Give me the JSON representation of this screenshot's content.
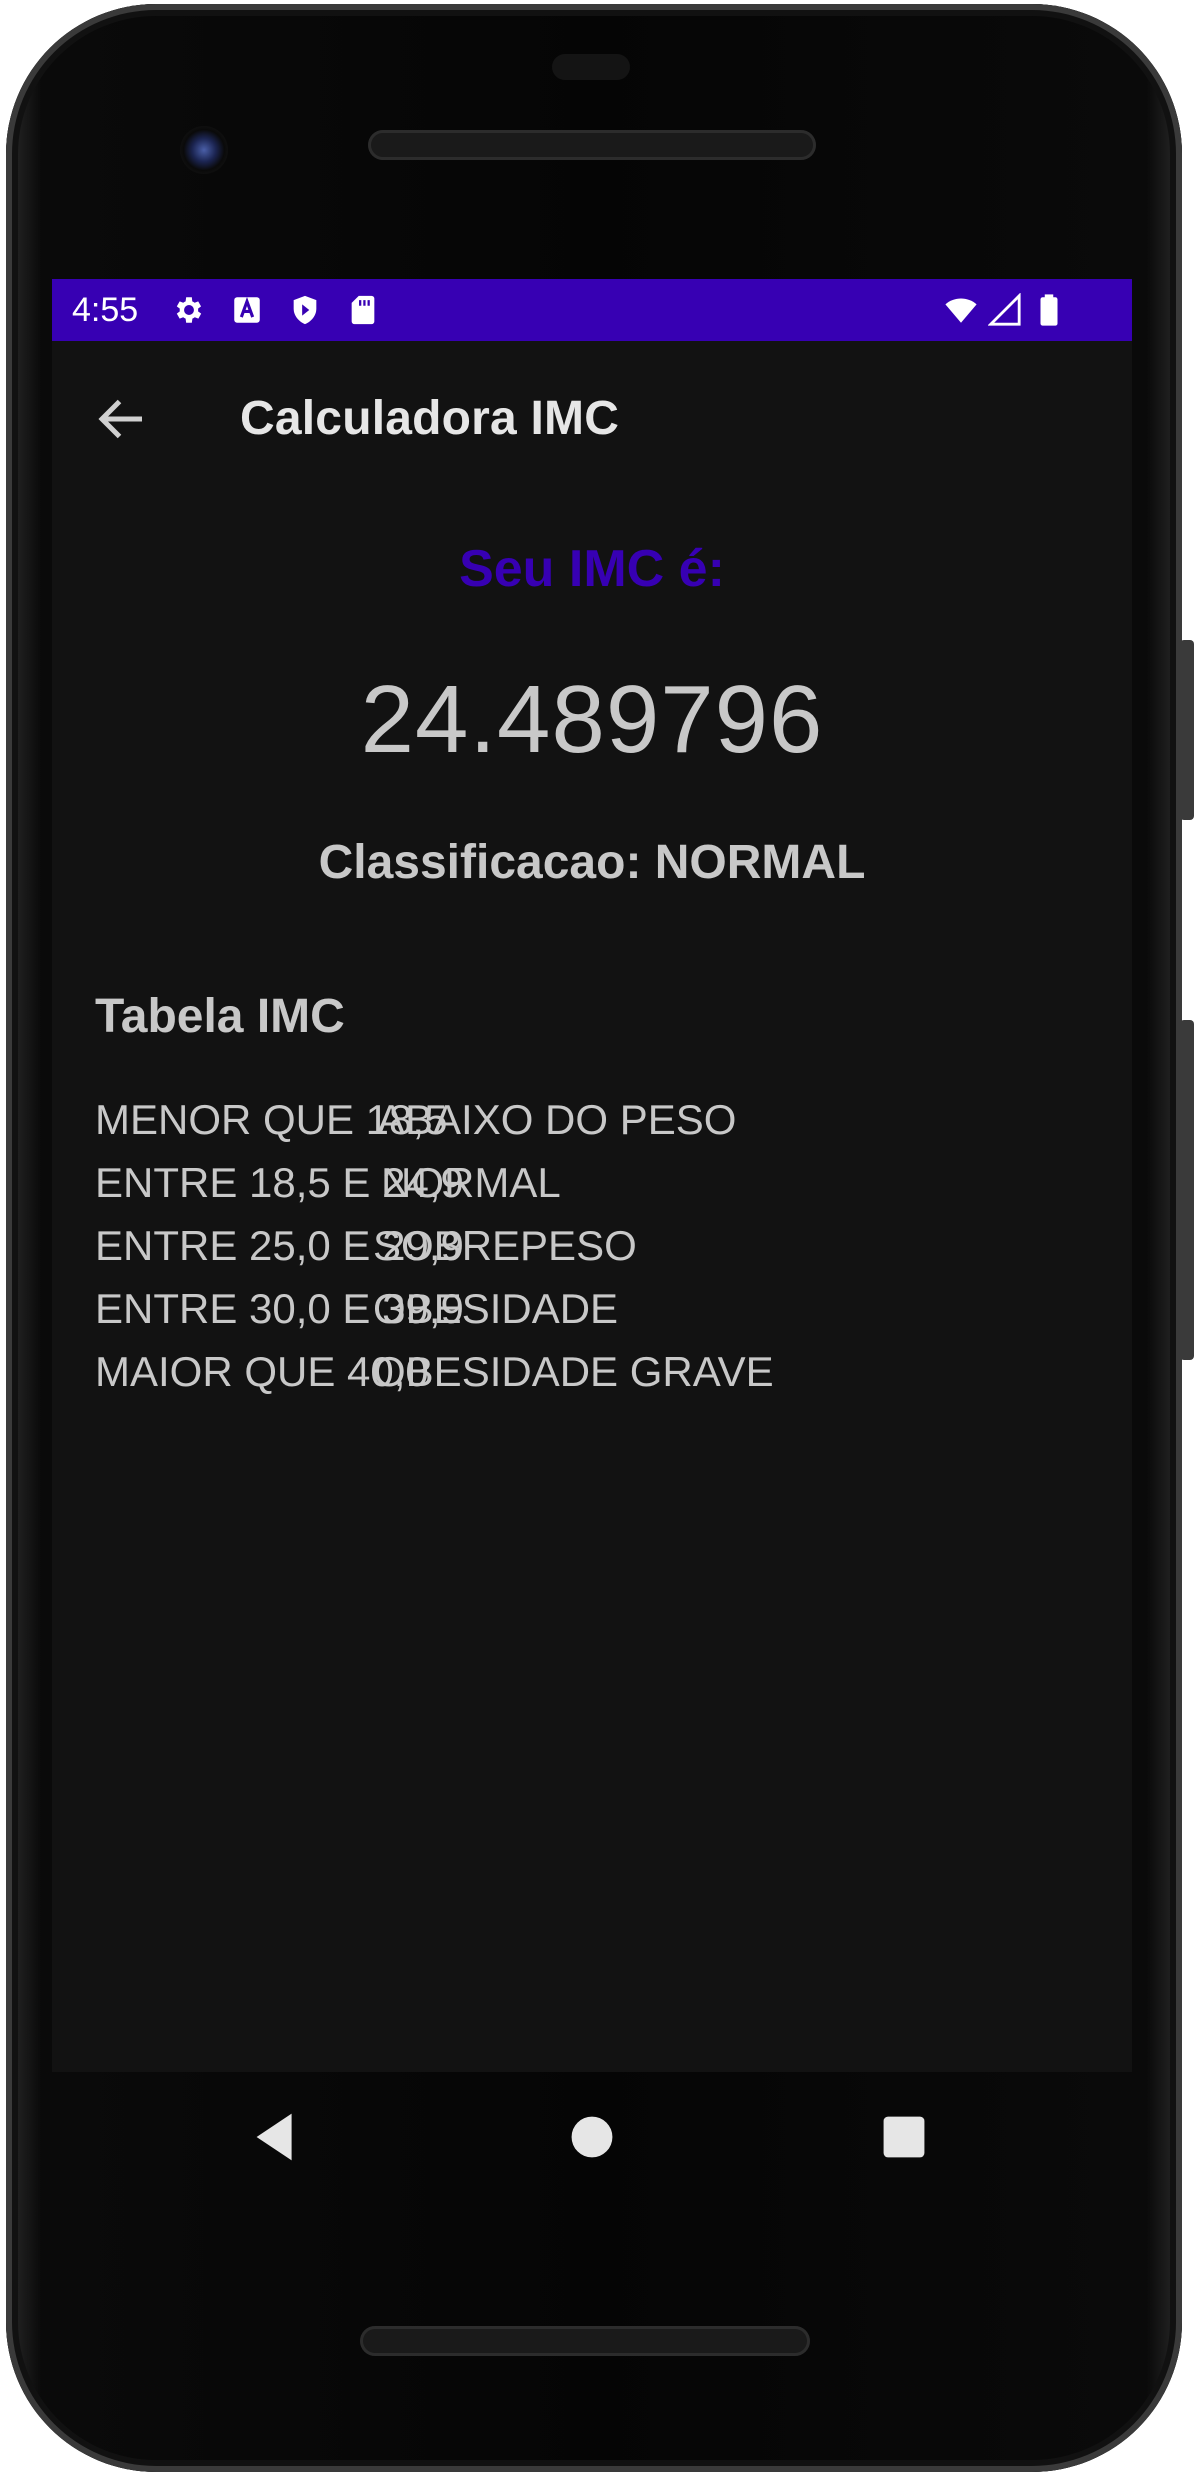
{
  "status_bar": {
    "time": "4:55",
    "left_icons": [
      "settings-icon",
      "a-icon",
      "shield-icon",
      "sd-card-icon"
    ],
    "right_icons": [
      "wifi-icon",
      "signal-icon",
      "battery-icon"
    ],
    "color": "#3700b3"
  },
  "app_bar": {
    "title": "Calculadora IMC",
    "back_icon": "arrow-back-icon"
  },
  "result": {
    "label": "Seu IMC é:",
    "value": "24.489796",
    "classification": "Classificacao: NORMAL"
  },
  "table": {
    "title": "Tabela IMC",
    "rows": [
      {
        "range": "MENOR QUE 18,5",
        "classification": "ABAIXO DO PESO"
      },
      {
        "range": "ENTRE 18,5 E 24,9",
        "classification": "NORMAL"
      },
      {
        "range": "ENTRE 25,0 E 29,9",
        "classification": "SOBREPESO"
      },
      {
        "range": "ENTRE 30,0 E 39,9",
        "classification": "OBESIDADE"
      },
      {
        "range": "MAIOR QUE 40,0",
        "classification": "OBESIDADE GRAVE"
      }
    ]
  },
  "nav_bar": {
    "icons": [
      "back-triangle-icon",
      "home-circle-icon",
      "recents-square-icon"
    ]
  },
  "colors": {
    "accent": "#3700b3",
    "background": "#121212",
    "text": "#c8c8c8"
  }
}
